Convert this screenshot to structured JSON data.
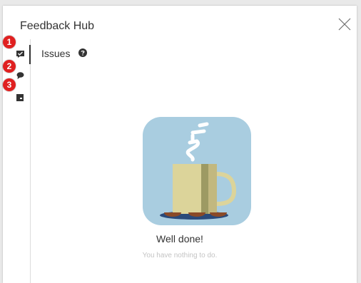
{
  "header": {
    "title": "Feedback Hub",
    "close_icon": "close-icon"
  },
  "rail": {
    "items": [
      {
        "icon": "issues-check-icon",
        "badge": "1",
        "active": true
      },
      {
        "icon": "comment-icon",
        "badge": "2",
        "active": false
      },
      {
        "icon": "notes-icon",
        "badge": "3",
        "active": false
      }
    ]
  },
  "section": {
    "label": "Issues",
    "help_icon": "question-circle-icon"
  },
  "empty_state": {
    "illustration": "coffee-mug-illustration",
    "title": "Well done!",
    "subtitle": "You have nothing to do."
  },
  "colors": {
    "badge": "#e02020",
    "illustration_bg": "#a9cde0",
    "mug": "#dcd49a",
    "mug_shade": "#9d9a63"
  }
}
